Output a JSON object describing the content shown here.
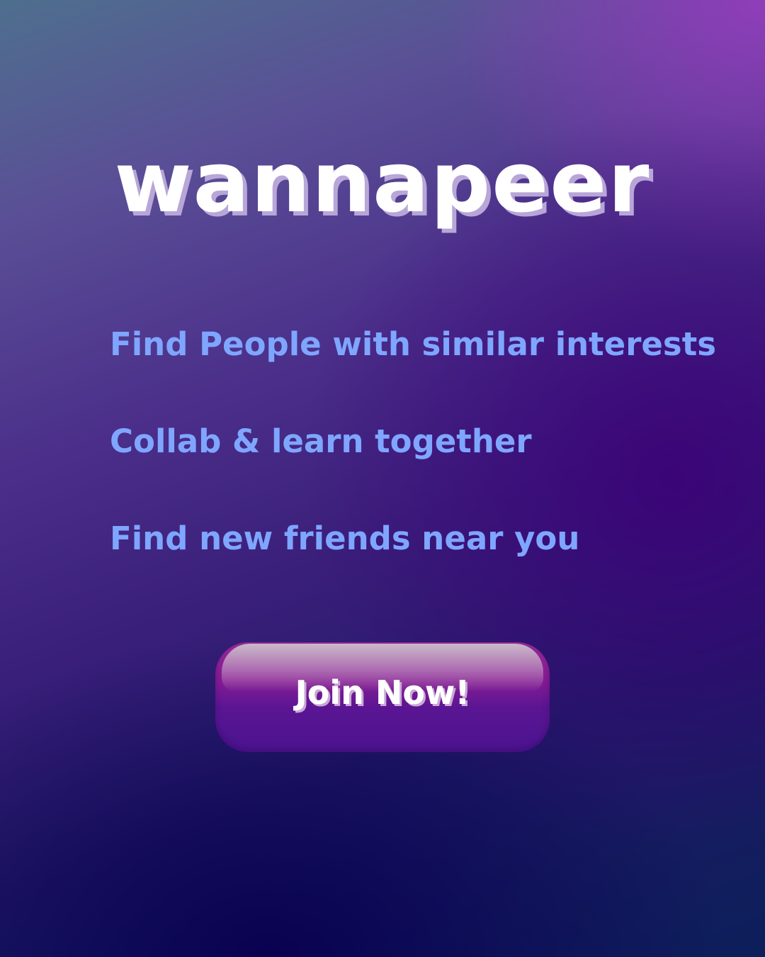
{
  "brand": {
    "logo_text": "wannapeer"
  },
  "features": [
    {
      "text": "Find People with similar interests"
    },
    {
      "text": "Collab & learn together"
    },
    {
      "text": "Find new friends near you"
    }
  ],
  "cta": {
    "label": "Join Now!"
  },
  "colors": {
    "feature_text": "#7fa6ff",
    "logo_text": "#ffffff",
    "logo_shadow": "#b8a6d8",
    "button_top": "#9a2a9a",
    "button_bottom": "#4c1490"
  }
}
